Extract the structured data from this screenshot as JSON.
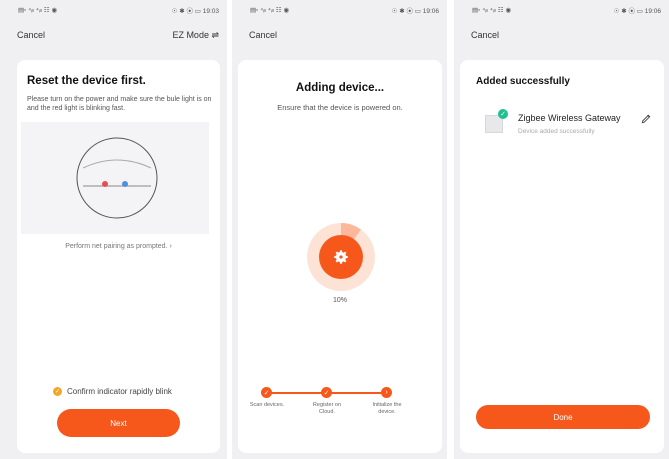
{
  "screen1": {
    "status_left": "▤▫ ⁴ᵢₗₗ ⁴ᵢₗₗ ☷ ◉",
    "status_right": "☉ ✱ ⦿ ▭ 19:03",
    "cancel": "Cancel",
    "mode": "EZ Mode ⇌",
    "title": "Reset the device first.",
    "instructions": "Please turn on the power and make sure the bule light is on and the red light is blinking fast.",
    "pairing_link": "Perform net pairing as prompted. ›",
    "confirm_label": "Confirm indicator rapidly blink",
    "next_button": "Next",
    "colors": {
      "accent": "#f6581c",
      "checkbox": "#f5a623",
      "red_light": "#e84d4d",
      "blue_light": "#4a8fe0"
    }
  },
  "screen2": {
    "status_left": "▤▫ ⁴ᵢₗₗ ⁴ᵢₗₗ ☷ ◉",
    "status_right": "☉ ✱ ⦿ ▭ 19:06",
    "cancel": "Cancel",
    "title": "Adding device...",
    "subtitle": "Ensure that the device is powered on.",
    "progress": "10%",
    "progress_value": 0.1,
    "steps": [
      {
        "label": "Scan devices."
      },
      {
        "label": "Register on Cloud."
      },
      {
        "label": "Initialize the device."
      }
    ],
    "icons": {
      "center": "gear-icon",
      "step_done": "check-icon",
      "step_current": "arrow-right-icon"
    }
  },
  "screen3": {
    "status_left": "▤▫ ⁴ᵢₗₗ ⁴ᵢₗₗ ☷ ◉",
    "status_right": "☉ ✱ ⦿ ▭ 19:06",
    "cancel": "Cancel",
    "title": "Added successfully",
    "device_name": "Zigbee Wireless Gateway",
    "device_status": "Device added successfully",
    "done_button": "Done",
    "icons": {
      "device": "gateway-device-icon",
      "badge": "check-badge-icon",
      "edit": "pencil-icon"
    },
    "colors": {
      "badge": "#1fbf8f"
    }
  }
}
